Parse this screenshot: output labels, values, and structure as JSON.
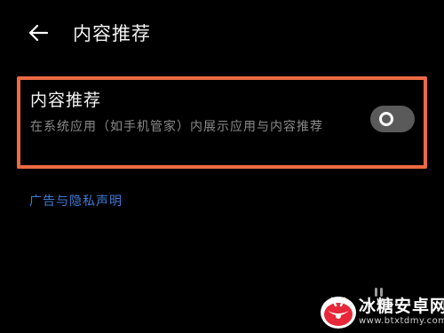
{
  "header": {
    "back_icon": "arrow-left-icon",
    "title": "内容推荐"
  },
  "setting": {
    "title": "内容推荐",
    "description": "在系统应用（如手机管家）内展示应用与内容推荐",
    "toggle_on": false,
    "highlight_color": "#ec6a43"
  },
  "links": {
    "privacy": "广告与隐私声明"
  },
  "watermark": {
    "name": "冰糖安卓网",
    "url": "www.btxtdmy.com"
  },
  "colors": {
    "background": "#000000",
    "link": "#3f7ad4",
    "toggle_off": "#5a5a5a"
  }
}
